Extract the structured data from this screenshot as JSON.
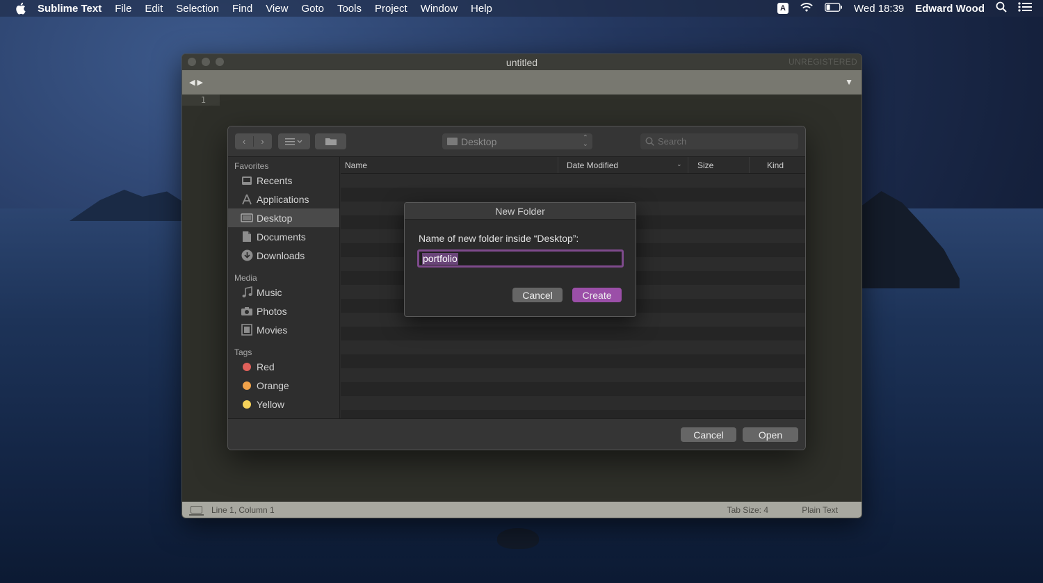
{
  "menubar": {
    "app_name": "Sublime Text",
    "menus": [
      "File",
      "Edit",
      "Selection",
      "Find",
      "View",
      "Goto",
      "Tools",
      "Project",
      "Window",
      "Help"
    ],
    "input_indicator": "A",
    "clock": "Wed 18:39",
    "user": "Edward Wood"
  },
  "editor": {
    "title": "untitled",
    "registration": "UNREGISTERED",
    "line_number": "1",
    "status": {
      "position": "Line 1, Column 1",
      "tab_size": "Tab Size: 4",
      "syntax": "Plain Text"
    }
  },
  "open_dialog": {
    "location": "Desktop",
    "search_placeholder": "Search",
    "sidebar": {
      "favorites_header": "Favorites",
      "favorites": [
        "Recents",
        "Applications",
        "Desktop",
        "Documents",
        "Downloads"
      ],
      "selected": "Desktop",
      "media_header": "Media",
      "media": [
        "Music",
        "Photos",
        "Movies"
      ],
      "tags_header": "Tags",
      "tags": [
        {
          "label": "Red",
          "color": "#e0605a"
        },
        {
          "label": "Orange",
          "color": "#f0a24a"
        },
        {
          "label": "Yellow",
          "color": "#f5d25a"
        }
      ]
    },
    "columns": [
      "Name",
      "Date Modified",
      "Size",
      "Kind"
    ],
    "cancel_label": "Cancel",
    "open_label": "Open"
  },
  "new_folder_sheet": {
    "title": "New Folder",
    "prompt": "Name of new folder inside “Desktop”:",
    "value": "portfolio",
    "cancel_label": "Cancel",
    "create_label": "Create",
    "accent_color": "#9b4fa8"
  }
}
